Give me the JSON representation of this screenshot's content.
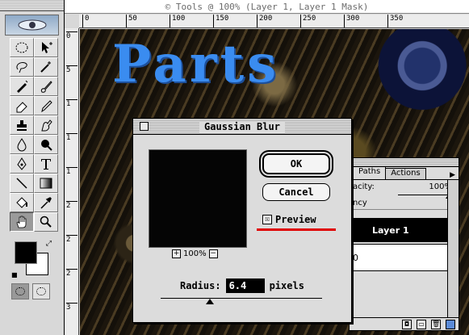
{
  "window": {
    "title": "© Tools @ 100% (Layer 1, Layer 1 Mask)"
  },
  "rulers": {
    "top_ticks": [
      "0",
      "50",
      "100",
      "150",
      "200",
      "250",
      "300",
      "350"
    ],
    "left_ticks": [
      "0",
      "5",
      "1",
      "1",
      "1",
      "2",
      "2",
      "2",
      "3"
    ]
  },
  "canvas": {
    "image_text": "Parts",
    "text_color": "#3a8cf0"
  },
  "toolbox": {
    "tools": [
      "marquee",
      "move",
      "lasso",
      "magic-wand",
      "airbrush",
      "paintbrush",
      "eraser",
      "pencil",
      "rubber-stamp",
      "smudge",
      "blur",
      "burn",
      "pen",
      "type",
      "line",
      "gradient",
      "paint-bucket",
      "eyedropper",
      "hand",
      "zoom"
    ],
    "selected_tool": "hand",
    "foreground_color": "#000000",
    "background_color": "#ffffff"
  },
  "dialog": {
    "title": "Gaussian Blur",
    "ok_label": "OK",
    "cancel_label": "Cancel",
    "preview_label": "Preview",
    "preview_checked": true,
    "preview_check_glyph": "☒",
    "zoom_minus": "−",
    "zoom_plus": "+",
    "zoom_level": "100%",
    "radius_label": "Radius:",
    "radius_value": "6.4",
    "radius_unit": "pixels",
    "highlight_color": "#e00000"
  },
  "layers_palette": {
    "tabs": [
      "Paths",
      "Actions"
    ],
    "opacity_label": "acity:",
    "opacity_value": "100%",
    "transparency_label": "ncy",
    "layer_name": "Layer 1",
    "layer_row2_value": "0"
  }
}
